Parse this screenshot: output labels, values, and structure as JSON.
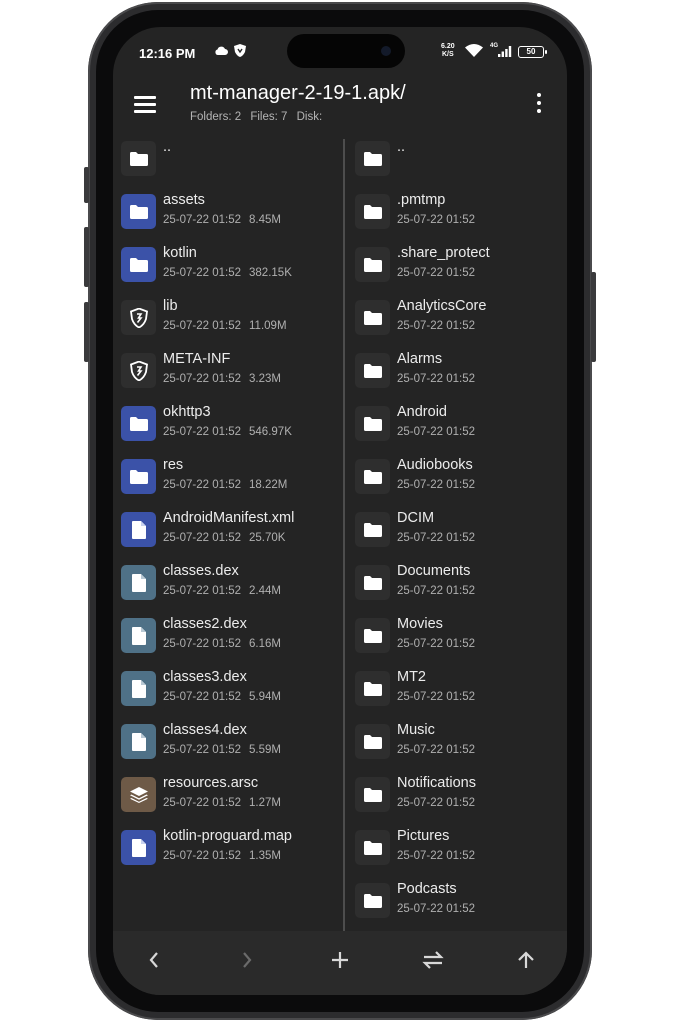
{
  "status": {
    "time": "12:16 PM",
    "net_speed_value": "6.20",
    "net_speed_unit": "K/S",
    "signal_label": "4G",
    "battery": "50"
  },
  "header": {
    "title": "mt-manager-2-19-1.apk/",
    "folders": "Folders: 2",
    "files": "Files: 7",
    "disk": "Disk:"
  },
  "left_pane": {
    "items": [
      {
        "name": "..",
        "date": "",
        "size": "",
        "icon": "folder-icon"
      },
      {
        "name": "assets",
        "date": "25-07-22 01:52",
        "size": "8.45M",
        "icon": "folder-icon"
      },
      {
        "name": "kotlin",
        "date": "25-07-22 01:52",
        "size": "382.15K",
        "icon": "folder-icon"
      },
      {
        "name": "lib",
        "date": "25-07-22 01:52",
        "size": "11.09M",
        "icon": "shield-icon"
      },
      {
        "name": "META-INF",
        "date": "25-07-22 01:52",
        "size": "3.23M",
        "icon": "shield-icon"
      },
      {
        "name": "okhttp3",
        "date": "25-07-22 01:52",
        "size": "546.97K",
        "icon": "folder-icon"
      },
      {
        "name": "res",
        "date": "25-07-22 01:52",
        "size": "18.22M",
        "icon": "folder-icon"
      },
      {
        "name": "AndroidManifest.xml",
        "date": "25-07-22 01:52",
        "size": "25.70K",
        "icon": "file-icon"
      },
      {
        "name": "classes.dex",
        "date": "25-07-22 01:52",
        "size": "2.44M",
        "icon": "file-icon"
      },
      {
        "name": "classes2.dex",
        "date": "25-07-22 01:52",
        "size": "6.16M",
        "icon": "file-icon"
      },
      {
        "name": "classes3.dex",
        "date": "25-07-22 01:52",
        "size": "5.94M",
        "icon": "file-icon"
      },
      {
        "name": "classes4.dex",
        "date": "25-07-22 01:52",
        "size": "5.59M",
        "icon": "file-icon"
      },
      {
        "name": "resources.arsc",
        "date": "25-07-22 01:52",
        "size": "1.27M",
        "icon": "layers-icon"
      },
      {
        "name": "kotlin-proguard.map",
        "date": "25-07-22 01:52",
        "size": "1.35M",
        "icon": "file-icon"
      }
    ]
  },
  "right_pane": {
    "items": [
      {
        "name": "..",
        "date": ""
      },
      {
        "name": ".pmtmp",
        "date": "25-07-22 01:52"
      },
      {
        "name": ".share_protect",
        "date": "25-07-22 01:52"
      },
      {
        "name": "AnalyticsCore",
        "date": "25-07-22 01:52"
      },
      {
        "name": "Alarms",
        "date": "25-07-22 01:52"
      },
      {
        "name": "Android",
        "date": "25-07-22 01:52"
      },
      {
        "name": "Audiobooks",
        "date": "25-07-22 01:52"
      },
      {
        "name": "DCIM",
        "date": "25-07-22 01:52"
      },
      {
        "name": "Documents",
        "date": "25-07-22 01:52"
      },
      {
        "name": "Movies",
        "date": "25-07-22 01:52"
      },
      {
        "name": "MT2",
        "date": "25-07-22 01:52"
      },
      {
        "name": "Music",
        "date": "25-07-22 01:52"
      },
      {
        "name": "Notifications",
        "date": "25-07-22 01:52"
      },
      {
        "name": "Pictures",
        "date": "25-07-22 01:52"
      },
      {
        "name": "Podcasts",
        "date": "25-07-22 01:52"
      }
    ]
  },
  "bottom_nav": {
    "buttons": [
      "back-arrow-icon",
      "forward-arrow-icon",
      "plus-icon",
      "swap-icon",
      "up-arrow-icon"
    ]
  },
  "colors": {
    "background": "#242424",
    "folder_blue": "#3b52a8",
    "dex_teal": "#4f7187",
    "arsc_brown": "#6e5a47"
  }
}
